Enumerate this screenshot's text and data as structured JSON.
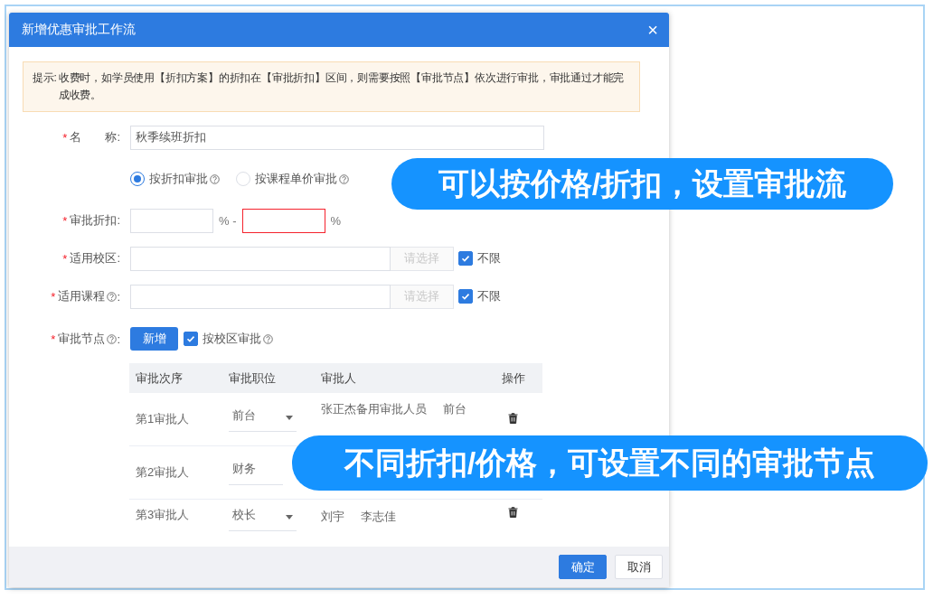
{
  "dialog": {
    "title": "新增优惠审批工作流",
    "close": "×"
  },
  "notice": {
    "label": "提示:",
    "text": "收费时，如学员使用【折扣方案】的折扣在【审批折扣】区间，则需要按照【审批节点】依次进行审批，审批通过才能完成收费。"
  },
  "name_field": {
    "label": "名　　称:",
    "required_mark": "*",
    "value": "秋季续班折扣"
  },
  "approval_mode": [
    {
      "label": "按折扣审批",
      "selected": true,
      "help": true
    },
    {
      "label": "按课程单价审批",
      "selected": false,
      "help": true
    }
  ],
  "discount": {
    "label": "审批折扣:",
    "required_mark": "*",
    "min": {
      "unit": "%",
      "invalid": false
    },
    "separator": "-",
    "max": {
      "unit": "%",
      "invalid": true
    }
  },
  "campus": {
    "label": "适用校区:",
    "required_mark": "*",
    "button": "请选择",
    "button_disabled": true,
    "unlimited": {
      "label": "不限",
      "checked": true
    }
  },
  "course": {
    "label": "适用课程",
    "required_mark": "*",
    "help": true,
    "colon": ":",
    "button": "请选择",
    "button_disabled": true,
    "unlimited": {
      "label": "不限",
      "checked": true
    }
  },
  "nodes": {
    "label": "审批节点",
    "required_mark": "*",
    "help": true,
    "colon": ":",
    "add_button": "新增",
    "by_campus": {
      "label": "按校区审批",
      "checked": true,
      "help": true
    }
  },
  "table": {
    "columns": [
      "审批次序",
      "审批职位",
      "审批人",
      "操作"
    ],
    "rows": [
      {
        "order": "第1审批人",
        "position": "前台",
        "caret": true,
        "approvers": [
          "张正杰备用审批人员",
          "前台"
        ],
        "delete": true
      },
      {
        "order": "第2审批人",
        "position": "财务",
        "caret": false,
        "approvers": [],
        "delete": false
      },
      {
        "order": "第3审批人",
        "position": "校长",
        "caret": true,
        "approvers": [
          "刘宇",
          "李志佳"
        ],
        "delete": true
      }
    ]
  },
  "footer": {
    "buttons": [
      {
        "label": "确定",
        "kind": "primary"
      },
      {
        "label": "取消",
        "kind": "default"
      }
    ]
  },
  "callouts": [
    {
      "text": "可以按价格/折扣，设置审批流"
    },
    {
      "text": "不同折扣/价格，可设置不同的审批节点"
    }
  ]
}
